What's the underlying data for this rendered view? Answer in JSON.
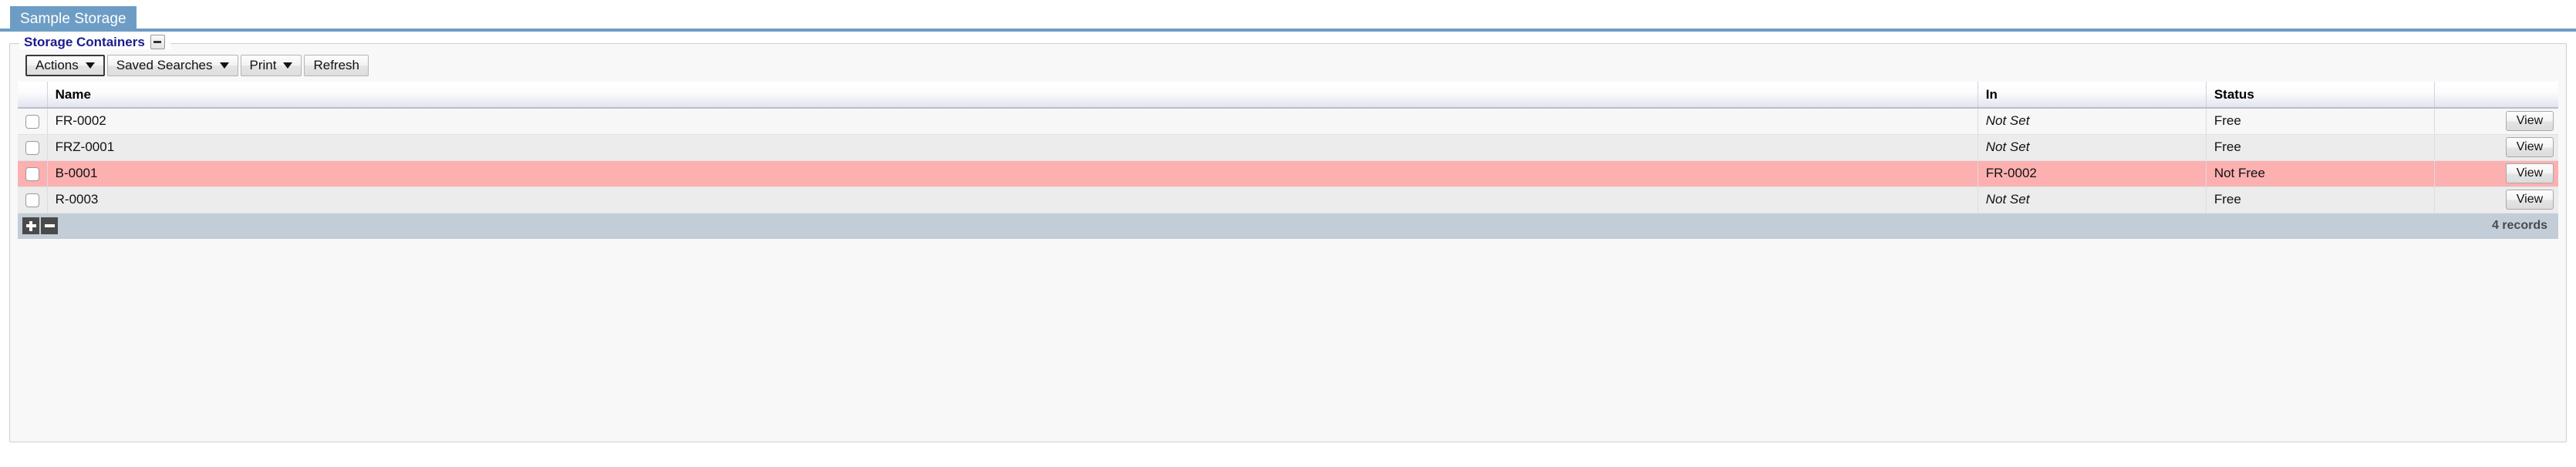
{
  "theme": {
    "tab_color": "#6d9dc5",
    "legend_color": "#1b1b8f",
    "flag_row_color": "#fcb0b0",
    "footer_color": "#c3cdd8"
  },
  "tabs": [
    {
      "label": "Sample Storage",
      "active": true
    }
  ],
  "panel": {
    "legend": "Storage Containers",
    "collapse_icon": "minus-icon"
  },
  "toolbar": {
    "buttons": [
      {
        "label": "Actions",
        "caret": true,
        "primary": true
      },
      {
        "label": "Saved Searches",
        "caret": true,
        "primary": false
      },
      {
        "label": "Print",
        "caret": true,
        "primary": false
      },
      {
        "label": "Refresh",
        "caret": false,
        "primary": false
      }
    ]
  },
  "grid": {
    "columns": [
      "",
      "Name",
      "In",
      "Status",
      ""
    ],
    "rows": [
      {
        "name": "FR-0002",
        "in": "Not Set",
        "in_unset": true,
        "status": "Free",
        "action": "View",
        "flagged": false
      },
      {
        "name": "FRZ-0001",
        "in": "Not Set",
        "in_unset": true,
        "status": "Free",
        "action": "View",
        "flagged": false
      },
      {
        "name": "B-0001",
        "in": "FR-0002",
        "in_unset": false,
        "status": "Not Free",
        "action": "View",
        "flagged": true
      },
      {
        "name": "R-0003",
        "in": "Not Set",
        "in_unset": true,
        "status": "Free",
        "action": "View",
        "flagged": false
      }
    ],
    "footer": {
      "add_icon": "plus-icon",
      "remove_icon": "minus-icon",
      "record_count": "4 records"
    }
  }
}
